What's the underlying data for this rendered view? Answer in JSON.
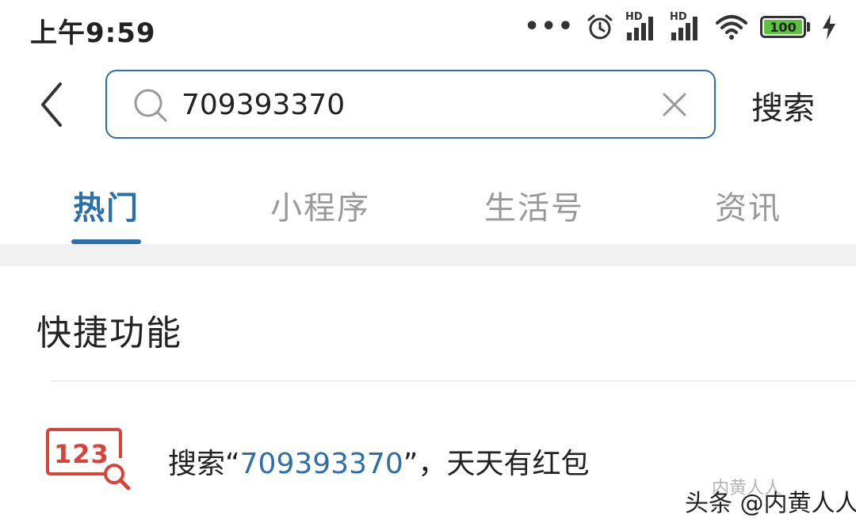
{
  "status_bar": {
    "time": "上午9:59",
    "more": "•••",
    "signal1_label": "HD",
    "signal2_label": "HD",
    "battery_level": "100"
  },
  "search": {
    "query": "709393370",
    "button_label": "搜索"
  },
  "tabs": [
    {
      "label": "热门",
      "active": true
    },
    {
      "label": "小程序",
      "active": false
    },
    {
      "label": "生活号",
      "active": false
    },
    {
      "label": "资讯",
      "active": false
    }
  ],
  "section": {
    "title": "快捷功能"
  },
  "quick_item": {
    "icon_text": "123",
    "prefix": "搜索“",
    "highlight": "709393370",
    "suffix": "”，天天有红包"
  },
  "watermark": {
    "faint": "内黄人人",
    "text": "头条 @内黄人人"
  },
  "colors": {
    "accent": "#2d6fa8",
    "icon_red": "#d9443a",
    "battery_green": "#5ac23d"
  }
}
